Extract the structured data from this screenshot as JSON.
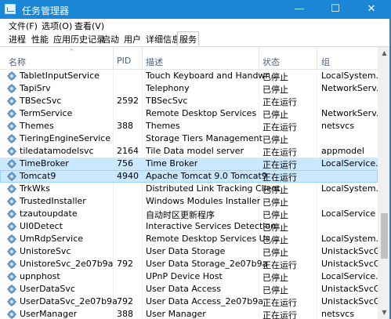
{
  "window": {
    "title": "任务管理器",
    "minimize": "—",
    "maximize": "☐",
    "close": "✕"
  },
  "menu": [
    "文件(F)",
    "选项(O)",
    "查看(V)"
  ],
  "tabs": [
    "进程",
    "性能",
    "应用历史记录",
    "启动",
    "用户",
    "详细信息",
    "服务"
  ],
  "active_tab": "服务",
  "columns": {
    "name": "名称",
    "pid": "PID",
    "desc": "描述",
    "status": "状态",
    "group": "组"
  },
  "sort_indicator": "^",
  "rows": [
    {
      "name": "TabletInputService",
      "pid": "",
      "desc": "Touch Keyboard and Handwr...",
      "status": "已停止",
      "group": "LocalSystem..."
    },
    {
      "name": "TapiSrv",
      "pid": "",
      "desc": "Telephony",
      "status": "已停止",
      "group": "NetworkServ..."
    },
    {
      "name": "TBSecSvc",
      "pid": "2592",
      "desc": "TBSecSvc",
      "status": "正在运行",
      "group": ""
    },
    {
      "name": "TermService",
      "pid": "",
      "desc": "Remote Desktop Services",
      "status": "已停止",
      "group": "NetworkServ..."
    },
    {
      "name": "Themes",
      "pid": "388",
      "desc": "Themes",
      "status": "正在运行",
      "group": "netsvcs"
    },
    {
      "name": "TieringEngineService",
      "pid": "",
      "desc": "Storage Tiers Management",
      "status": "已停止",
      "group": ""
    },
    {
      "name": "tiledatamodelsvc",
      "pid": "2164",
      "desc": "Tile Data model server",
      "status": "正在运行",
      "group": "appmodel"
    },
    {
      "name": "TimeBroker",
      "pid": "756",
      "desc": "Time Broker",
      "status": "正在运行",
      "group": "LocalService..."
    },
    {
      "name": "Tomcat9",
      "pid": "4940",
      "desc": "Apache Tomcat 9.0 Tomcat9",
      "status": "正在运行",
      "group": ""
    },
    {
      "name": "TrkWks",
      "pid": "",
      "desc": "Distributed Link Tracking Client",
      "status": "已停止",
      "group": "LocalSystem..."
    },
    {
      "name": "TrustedInstaller",
      "pid": "",
      "desc": "Windows Modules Installer",
      "status": "已停止",
      "group": ""
    },
    {
      "name": "tzautoupdate",
      "pid": "",
      "desc": "自动时区更新程序",
      "status": "已停止",
      "group": "LocalService"
    },
    {
      "name": "UI0Detect",
      "pid": "",
      "desc": "Interactive Services Detection",
      "status": "已停止",
      "group": ""
    },
    {
      "name": "UmRdpService",
      "pid": "",
      "desc": "Remote Desktop Services Us...",
      "status": "已停止",
      "group": "LocalSystem..."
    },
    {
      "name": "UnistoreSvc",
      "pid": "",
      "desc": "User Data Storage",
      "status": "已停止",
      "group": "UnistackSvcG..."
    },
    {
      "name": "UnistoreSvc_2e07b9a",
      "pid": "792",
      "desc": "User Data Storage_2e07b9a",
      "status": "正在运行",
      "group": "UnistackSvcG..."
    },
    {
      "name": "upnphost",
      "pid": "",
      "desc": "UPnP Device Host",
      "status": "已停止",
      "group": "LocalService..."
    },
    {
      "name": "UserDataSvc",
      "pid": "",
      "desc": "User Data Access",
      "status": "已停止",
      "group": "UnistackSvcG..."
    },
    {
      "name": "UserDataSvc_2e07b9a",
      "pid": "792",
      "desc": "User Data Access_2e07b9a",
      "status": "正在运行",
      "group": "UnistackSvcG..."
    },
    {
      "name": "UserManager",
      "pid": "388",
      "desc": "User Manager",
      "status": "正在运行",
      "group": "netsvcs"
    }
  ],
  "hover_row": "TimeBroker",
  "selected_row": "Tomcat9",
  "colors": {
    "titlebar": "#1b86d6",
    "selection": "#cce8ff",
    "header_text": "#4c607a"
  },
  "icon": "service-gear-icon"
}
